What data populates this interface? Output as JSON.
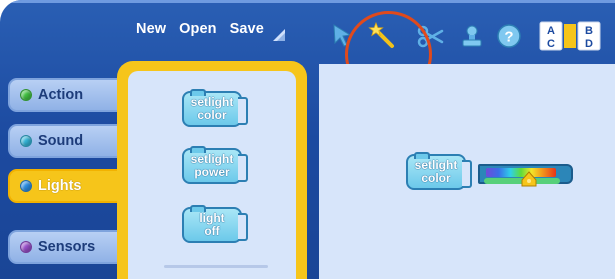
{
  "menu": {
    "new_label": "New",
    "open_label": "Open",
    "save_label": "Save"
  },
  "toolbar": {
    "icons": [
      "arrow-pointer-icon",
      "magic-wand-icon",
      "scissors-icon",
      "stamp-icon",
      "help-icon",
      "abcd-grid-icon"
    ],
    "help_glyph": "?",
    "abcd": [
      "A",
      "B",
      "C",
      "D"
    ],
    "highlight_color": "#e04a1c"
  },
  "tabs": [
    {
      "label": "Action",
      "dot_color": "#43c343",
      "active": false
    },
    {
      "label": "Sound",
      "dot_color": "#35b6d9",
      "active": false
    },
    {
      "label": "Lights",
      "dot_color": "#2b8fe6",
      "active": true
    },
    {
      "label": "Sensors",
      "dot_color": "#9a4fcc",
      "active": false
    }
  ],
  "palette": {
    "blocks": [
      {
        "line1": "setlight",
        "line2": "color"
      },
      {
        "line1": "setlight",
        "line2": "power"
      },
      {
        "line1": "light",
        "line2": "off"
      }
    ]
  },
  "canvas": {
    "block": {
      "line1": "setlight",
      "line2": "color"
    },
    "color_slider_position": 0.62
  },
  "colors": {
    "frame_blue": "#1c4aa0",
    "palette_yellow": "#f6c51a",
    "canvas_bg": "#d7e5fa"
  }
}
